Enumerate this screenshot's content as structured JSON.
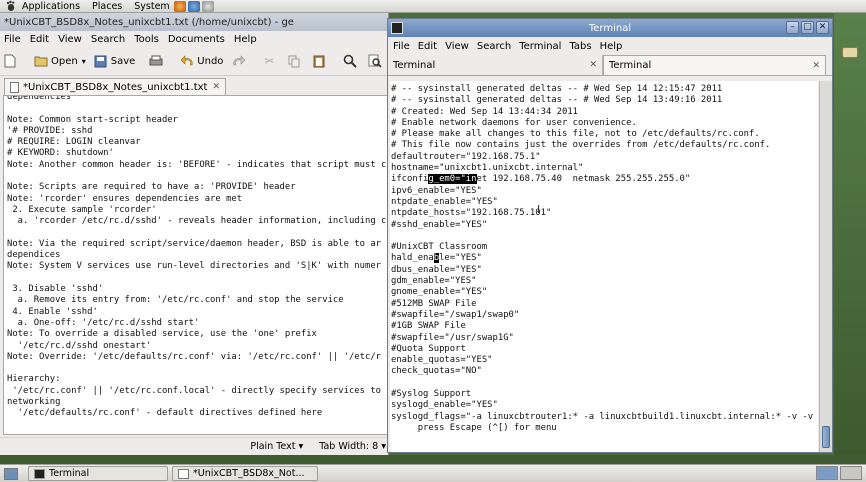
{
  "top_panel": {
    "menus": [
      "Applications",
      "Places",
      "System"
    ]
  },
  "gedit": {
    "title": "*UnixCBT_BSD8x_Notes_unixcbt1.txt (/home/unixcbt) - ge",
    "menu": [
      "File",
      "Edit",
      "View",
      "Search",
      "Tools",
      "Documents",
      "Help"
    ],
    "toolbar": {
      "open_label": "Open",
      "save_label": "Save",
      "undo_label": "Undo"
    },
    "tab_label": "*UnixCBT_BSD8x_Notes_unixcbt1.txt",
    "text": "dependencies\n\nNote: Common start-script header\n'# PROVIDE: sshd\n# REQUIRE: LOGIN cleanvar\n# KEYWORD: shutdown'\nNote: Another common header is: 'BEFORE' - indicates that script must c\n\nNote: Scripts are required to have a: 'PROVIDE' header\nNote: 'rcorder' ensures dependencies are met\n 2. Execute sample 'rcorder'\n  a. 'rcorder /etc/rc.d/sshd' - reveals header information, including c\n\nNote: Via the required script/service/daemon header, BSD is able to ar\ndependices\nNote: System V services use run-level directories and 'S|K' with numer\n\n 3. Disable 'sshd'\n  a. Remove its entry from: '/etc/rc.conf' and stop the service\n 4. Enable 'sshd'\n  a. One-off: '/etc/rc.d/sshd start'\nNote: To override a disabled service, use the 'one' prefix\n  '/etc/rc.d/sshd onestart'\nNote: Override: '/etc/defaults/rc.conf' via: '/etc/rc.conf' || '/etc/r\n\nHierarchy:\n '/etc/rc.conf' || '/etc/rc.conf.local' - directly specify services to\nnetworking\n  '/etc/defaults/rc.conf' - default directives defined here",
    "status": {
      "language": "Plain Text ▾",
      "tab_width": "Tab Width: 8 ▾"
    }
  },
  "terminal": {
    "title": "Terminal",
    "menu": [
      "File",
      "Edit",
      "View",
      "Search",
      "Terminal",
      "Tabs",
      "Help"
    ],
    "tabs": [
      "Terminal",
      "Terminal"
    ],
    "lines_before_sel1": "# -- sysinstall generated deltas -- # Wed Sep 14 12:15:47 2011\n# -- sysinstall generated deltas -- # Wed Sep 14 13:49:16 2011\n# Created: Wed Sep 14 13:44:34 2011\n# Enable network daemons for user convenience.\n# Please make all changes to this file, not to /etc/defaults/rc.conf.\n# This file now contains just the overrides from /etc/defaults/rc.conf.\ndefaultrouter=\"192.168.75.1\"\nhostname=\"unixcbt1.unixcbt.internal\"\nifconfi",
    "sel1": "g_em0=\"in",
    "lines_between": "et 192.168.75.40  netmask 255.255.255.0\"\nipv6_enable=\"YES\"\nntpdate_enable=\"YES\"\nntpdate_hosts=\"192.168.75.101\"\n#sshd_enable=\"YES\"\n\n#UnixCBT Classroom\nhald_ena",
    "sel2": "b",
    "lines_after": "le=\"YES\"\ndbus_enable=\"YES\"\ngdm_enable=\"YES\"\ngnome_enable=\"YES\"\n#512MB SWAP File\n#swapfile=\"/swap1/swap0\"\n#1GB SWAP File\n#swapfile=\"/usr/swap1G\"\n#Quota Support\nenable_quotas=\"YES\"\ncheck_quotas=\"NO\"\n\n#Syslog Support\nsyslogd_enable=\"YES\"\nsyslogd_flags=\"-a linuxcbtrouter1:* -a linuxcbtbuild1.linuxcbt.internal:* -v -v\n     press Escape (^[) for menu"
  },
  "taskbar": {
    "tasks": [
      "Terminal",
      "*UnixCBT_BSD8x_Not..."
    ]
  },
  "colors": {
    "desktop": "#4a6b3a",
    "terminal_title": "#5f83b5"
  }
}
